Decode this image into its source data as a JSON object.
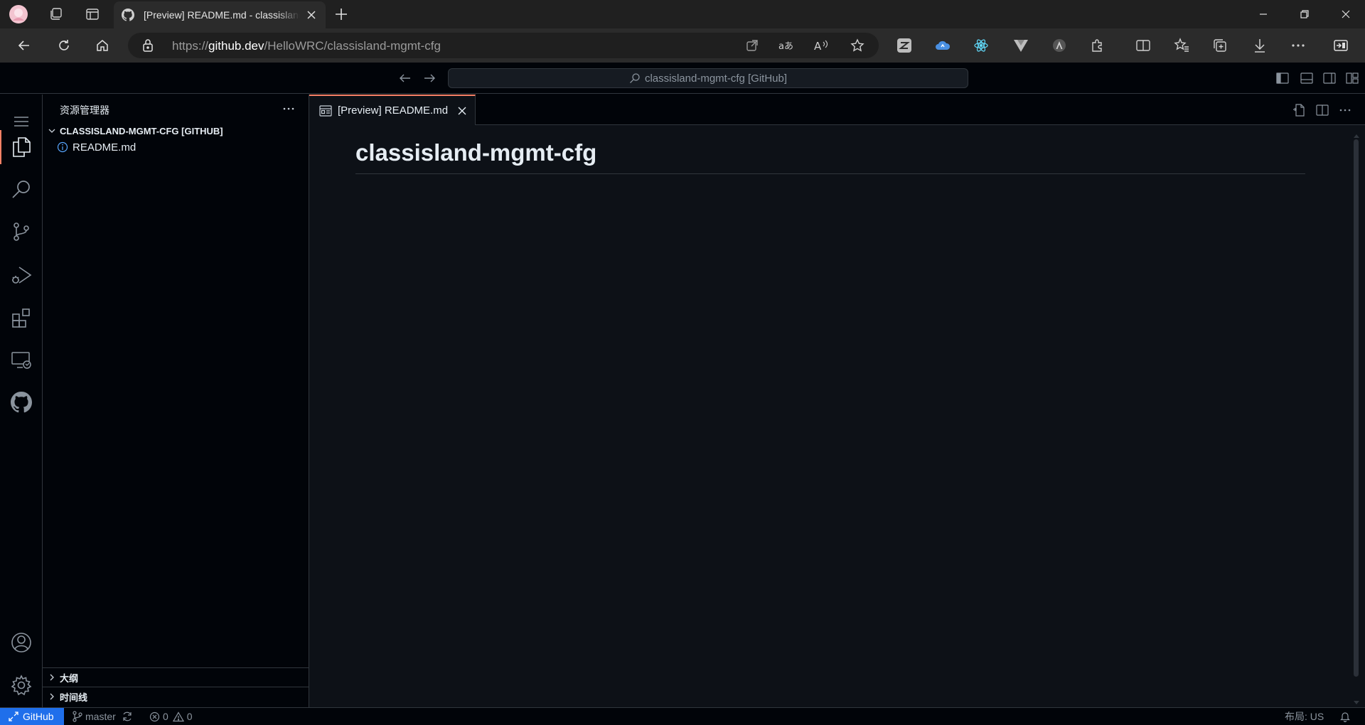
{
  "browser": {
    "tab_title": "[Preview] README.md - classisland-mgmt-cfg",
    "url_scheme": "https://",
    "url_host": "github.dev",
    "url_path": "/HelloWRC/classisland-mgmt-cfg",
    "new_tab_label": "+"
  },
  "vscode": {
    "command_center": "classisland-mgmt-cfg [GitHub]",
    "sidebar": {
      "title": "资源管理器",
      "repo": "CLASSISLAND-MGMT-CFG [GITHUB]",
      "files": [
        "README.md"
      ],
      "sections": [
        "大纲",
        "时间线"
      ]
    },
    "editor": {
      "tab_label": "[Preview] README.md",
      "heading": "classisland-mgmt-cfg"
    },
    "status": {
      "remote": "GitHub",
      "branch": "master",
      "errors": "0",
      "warnings": "0",
      "layout": "布局: US"
    }
  },
  "colors": {
    "accent": "#f78166",
    "remote_bg": "#1f6feb",
    "editor_bg": "#0d1117",
    "chrome_bg": "#010409"
  }
}
